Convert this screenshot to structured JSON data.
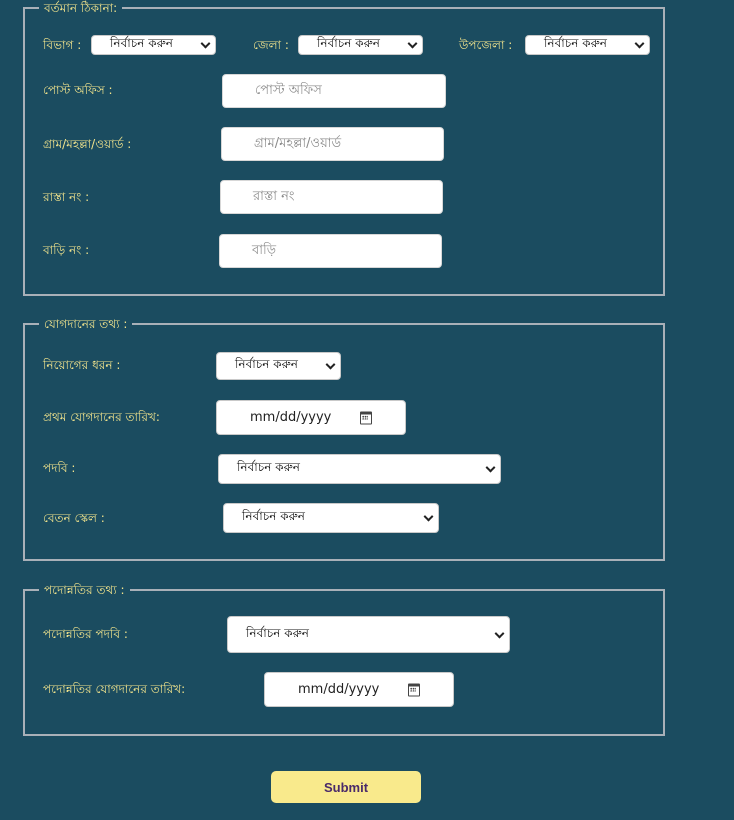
{
  "address": {
    "legend": "বর্তমান ঠিকানা:",
    "division_label": "বিভাগ :",
    "division_value": "নির্বাচন করুন",
    "district_label": "জেলা :",
    "district_value": "নির্বাচন করুন",
    "upazila_label": "উপজেলা :",
    "upazila_value": "নির্বাচন করুন",
    "post_office_label": "পোস্ট অফিস :",
    "post_office_placeholder": "পোস্ট অফিস",
    "village_label": "গ্রাম/মহল্লা/ওয়ার্ড :",
    "village_placeholder": "গ্রাম/মহল্লা/ওয়ার্ড",
    "road_label": "রাস্তা নং :",
    "road_placeholder": "রাস্তা নং",
    "house_label": "বাড়ি নং :",
    "house_placeholder": "বাড়ি"
  },
  "joining": {
    "legend": "যোগদানের তথ্য :",
    "appointment_type_label": "নিয়োগের ধরন :",
    "appointment_type_value": "নির্বাচন করুন",
    "first_join_date_label": "প্রথম যোগদানের তারিখ:",
    "first_join_date_value": "mm/dd/yyyy",
    "designation_label": "পদবি :",
    "designation_value": "নির্বাচন করুন",
    "pay_scale_label": "বেতন স্কেল :",
    "pay_scale_value": "নির্বাচন করুন"
  },
  "promotion": {
    "legend": "পদোন্নতির তথ্য :",
    "designation_label": "পদোন্নতির পদবি :",
    "designation_value": "নির্বাচন করুন",
    "join_date_label": "পদোন্নতির যোগদানের তারিখ:",
    "join_date_value": "mm/dd/yyyy"
  },
  "submit_label": "Submit"
}
